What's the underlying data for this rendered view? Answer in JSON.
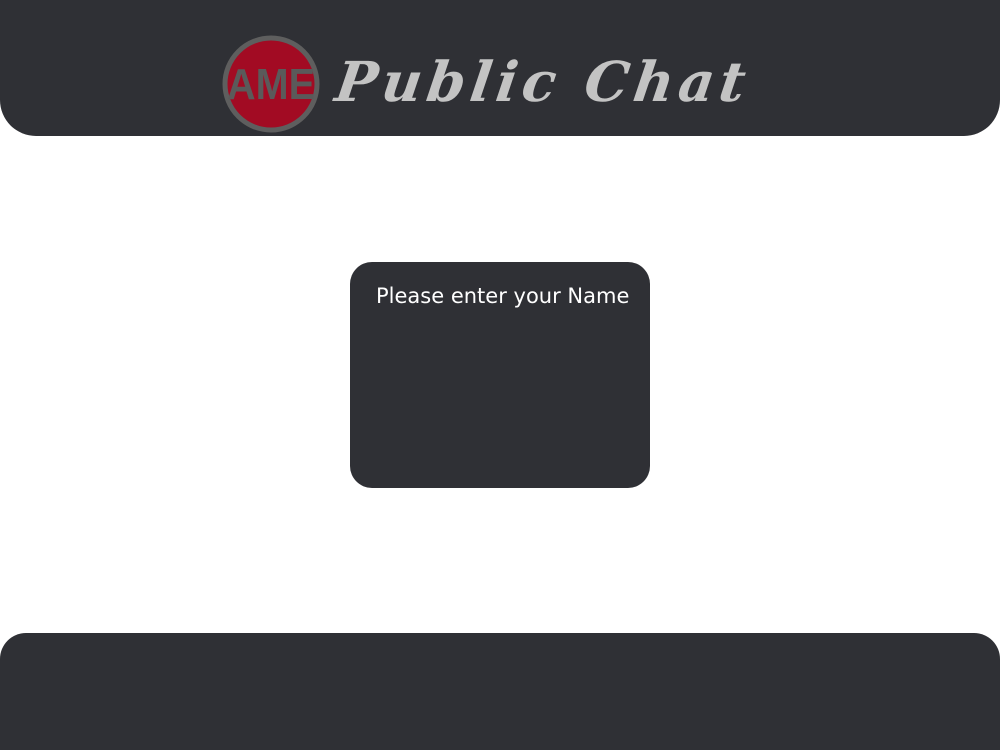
{
  "header": {
    "logo": {
      "icon": "ame-logo-icon",
      "text": "AME",
      "ring_color": "#5e5e5e",
      "fill_color": "#a20b23",
      "text_color": "#5a5a5a"
    },
    "title": "Public Chat",
    "title_color": "#c3c3c3"
  },
  "name_card": {
    "prompt": "Please enter your Name",
    "input_value": ""
  },
  "colors": {
    "panel_background": "#2f3035",
    "page_background": "#ffffff",
    "prompt_text": "#ffffff"
  }
}
